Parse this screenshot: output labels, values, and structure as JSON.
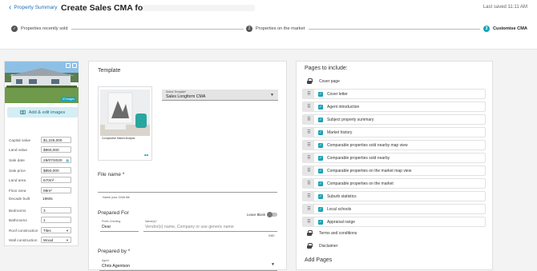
{
  "header": {
    "back_label": "Property Summary",
    "title": "Create Sales CMA for",
    "saved": "Last saved 11:11 AM"
  },
  "steps": [
    {
      "num": "✓",
      "label": "Properties recently sold"
    },
    {
      "num": "2",
      "label": "Properties on the market"
    },
    {
      "num": "3",
      "label": "Customise CMA"
    }
  ],
  "left_panel": {
    "image_count": "20 images",
    "add_images": "Add & edit images",
    "fields": [
      {
        "label": "Capital value",
        "value": "$1,225,000"
      },
      {
        "label": "Land value",
        "value": "$860,000"
      },
      {
        "label": "Sale date",
        "value": "28/07/2020"
      },
      {
        "label": "Sale price",
        "value": "$850,000"
      },
      {
        "label": "Land area",
        "value": "670m²"
      },
      {
        "label": "Floor area",
        "value": "98m²"
      },
      {
        "label": "Decade built",
        "value": "1960s"
      },
      {
        "label": "Bedrooms",
        "value": "3"
      },
      {
        "label": "Bathrooms",
        "value": "1"
      },
      {
        "label": "Roof construction",
        "value": "Tiles"
      },
      {
        "label": "Wall construction",
        "value": "Wood"
      }
    ]
  },
  "center": {
    "template_heading": "Template",
    "thumb_title": "Comparative Market Analysis",
    "select_label": "Select Template*",
    "select_value": "Sales Longform CMA",
    "file_name_heading": "File name *",
    "file_name_help": "Name your CMA file",
    "prepared_for_heading": "Prepared For",
    "leave_blank": "Leave Blank",
    "greeting_label": "Prefix Greeting",
    "greeting_value": "Dear",
    "names_label": "Name(s)*",
    "names_placeholder": "Vendor(s) name, Company or use generic name",
    "counter": "0/80",
    "prepared_by_heading": "Prepared by *",
    "agent_label": "Agent",
    "agent_value": "Chris Agentson"
  },
  "right": {
    "heading": "Pages to include:",
    "cover": "Cover page",
    "items": [
      "Cover letter",
      "Agent introduction",
      "Subject property summary",
      "Market history",
      "Comparable properties sold nearby map view",
      "Comparable properties sold nearby",
      "Comparable properties on the market map view",
      "Comparable properties on the market",
      "Suburb statistics",
      "Local schools",
      "Appraisal range"
    ],
    "terms": "Terms and conditions",
    "disclaimer": "Disclaimer",
    "add_pages": "Add Pages"
  }
}
